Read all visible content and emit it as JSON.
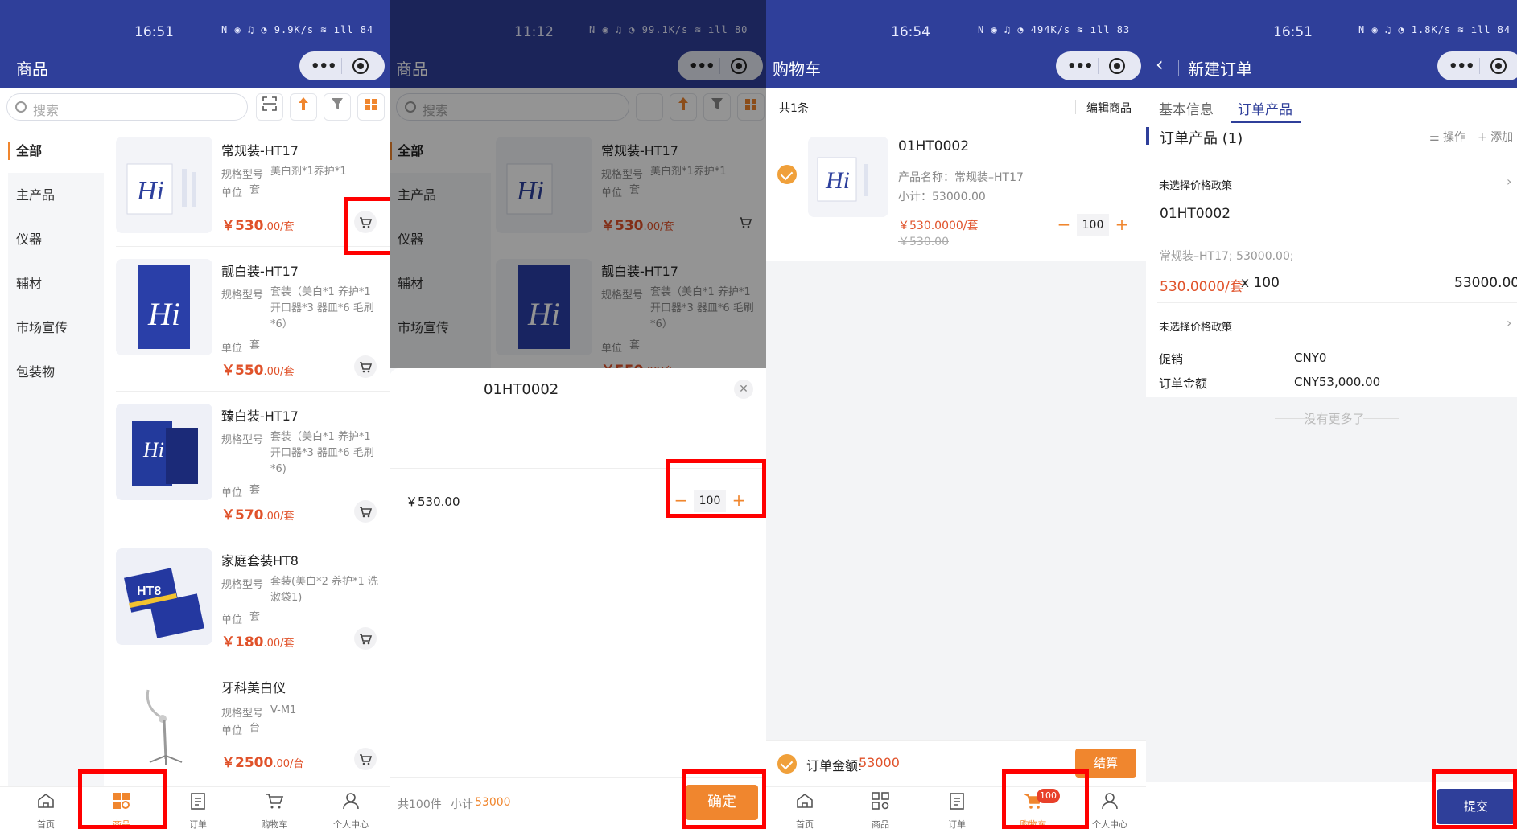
{
  "panel1": {
    "status": {
      "time": "16:51",
      "icons": "N ◉ ♫ ◔ 9.9K/s ≋ ıll 84"
    },
    "title": "商品",
    "search_placeholder": "搜索",
    "categories": [
      {
        "label": "全部",
        "active": true
      },
      {
        "label": "主产品"
      },
      {
        "label": "仪器"
      },
      {
        "label": "辅材"
      },
      {
        "label": "市场宣传"
      },
      {
        "label": "包装物"
      }
    ],
    "spec_label": "规格型号",
    "unit_label": "单位",
    "products": [
      {
        "name": "常规装-HT17",
        "spec": "美白剂*1养护*1",
        "unit": "套",
        "price": "￥530",
        "price_suffix": ".00/套"
      },
      {
        "name": "靓白装-HT17",
        "spec": "套装（美白*1 养护*1 开口器*3 器皿*6 毛刷*6）",
        "unit": "套",
        "price": "￥550",
        "price_suffix": ".00/套"
      },
      {
        "name": "臻白装-HT17",
        "spec": "套装（美白*1 养护*1 开口器*3 器皿*6 毛刷*6)",
        "unit": "套",
        "price": "￥570",
        "price_suffix": ".00/套"
      },
      {
        "name": "家庭套装HT8",
        "spec": "套装(美白*2 养护*1 洗漱袋1)",
        "unit": "套",
        "price": "￥180",
        "price_suffix": ".00/套"
      },
      {
        "name": "牙科美白仪",
        "spec": "V-M1",
        "unit": "台",
        "price": "￥2500",
        "price_suffix": ".00/台"
      }
    ],
    "tabs": [
      {
        "label": "首页",
        "icon": "home-icon"
      },
      {
        "label": "商品",
        "icon": "products-icon",
        "active": true
      },
      {
        "label": "订单",
        "icon": "orders-icon"
      },
      {
        "label": "购物车",
        "icon": "cart-icon"
      },
      {
        "label": "个人中心",
        "icon": "profile-icon"
      }
    ]
  },
  "panel2": {
    "status": {
      "time": "11:12",
      "icons": "N ◉ ♫ ◔ 99.1K/s ≋ ıll 80"
    },
    "sheet": {
      "product_code": "01HT0002",
      "price": "￥530.00",
      "qty": "100",
      "total_label": "共100件",
      "subtotal_label": "小计",
      "subtotal_value": "53000",
      "confirm": "确定"
    }
  },
  "panel3": {
    "status": {
      "time": "16:54",
      "icons": "N ◉ ♫ ◔ 494K/s ≋ ıll 83"
    },
    "title": "购物车",
    "count_text": "共1条",
    "edit_label": "编辑商品",
    "item": {
      "code": "01HT0002",
      "name_line": "产品名称：常规装–HT17",
      "subtotal_line": "小计：53000.00",
      "price": "￥530.0000/套",
      "original_price": "￥530.00",
      "qty": "100"
    },
    "footer": {
      "amount_label": "订单金额:",
      "amount_value": "53000",
      "checkout": "结算"
    },
    "cart_badge": "100"
  },
  "panel4": {
    "status": {
      "time": "16:51",
      "icons": "N ◉ ♫ ◔ 1.8K/s ≋ ıll 84"
    },
    "title": "新建订单",
    "tabs": [
      "基本信息",
      "订单产品"
    ],
    "section_title": "订单产品 (1)",
    "operate": "操作",
    "add": "添加",
    "policy_text": "未选择价格政策",
    "product_code": "01HT0002",
    "product_desc": "常规装–HT17; 53000.00;",
    "unit_price": "530.0000/套",
    "times_qty": " x 100",
    "line_total": "53000.00",
    "policy_text2": "未选择价格政策",
    "promo_label": "促销",
    "promo_value": "CNY0",
    "amount_label": "订单金额",
    "amount_value": "CNY53,000.00",
    "no_more": "没有更多了",
    "submit": "提交"
  }
}
